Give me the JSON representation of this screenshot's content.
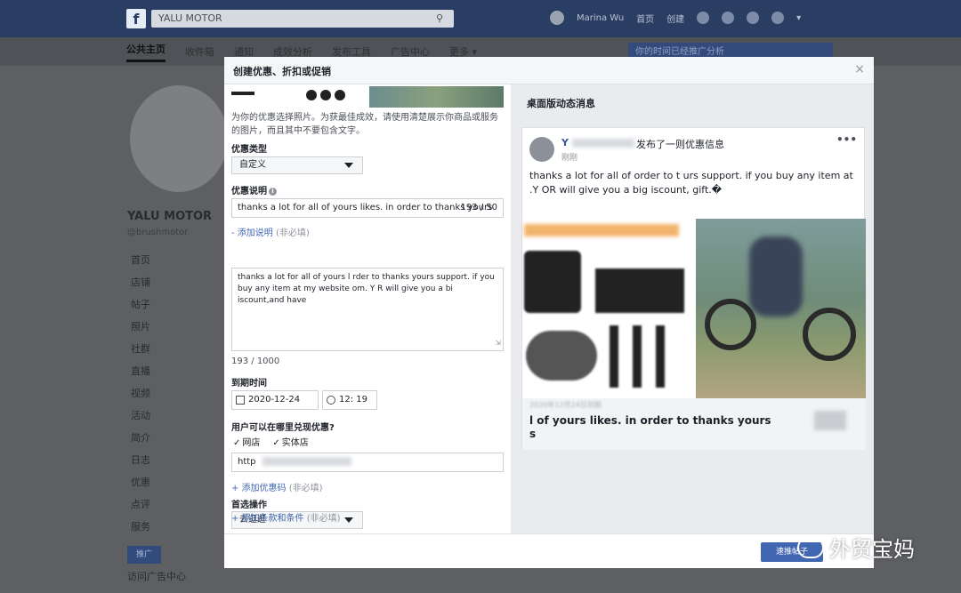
{
  "topbar": {
    "logo": "f",
    "search_value": "YALU MOTOR",
    "search_icon": "search-icon",
    "user_name": "Marina Wu",
    "home": "首页",
    "create": "创建"
  },
  "subnav": {
    "tabs": [
      "公共主页",
      "收件箱",
      "通知",
      "成效分析",
      "发布工具",
      "广告中心",
      "更多 ▾"
    ],
    "notice": "你的时间已经推广分析"
  },
  "left_page": {
    "page_name": "YALU MOTOR",
    "handle": "@brushmotor",
    "menu": [
      "首页",
      "店铺",
      "帖子",
      "照片",
      "社群",
      "直播",
      "视频",
      "活动",
      "简介",
      "日志",
      "优惠",
      "点评",
      "服务"
    ],
    "promote_button": "推广",
    "ad_center_link": "访问广告中心"
  },
  "modal": {
    "title": "创建优惠、折扣或促销",
    "close": "×",
    "photo_help": "为你的优惠选择照片。为获最佳成效，请使用清楚展示你商品或服务的图片，而且其中不要包含文字。",
    "offer_type_label": "优惠类型",
    "offer_type_value": "自定义",
    "offer_desc_label": "优惠说明",
    "offer_desc_value": "thanks a lot for all of yours likes. in order to thanks yours",
    "offer_desc_count": "193 / 50",
    "add_details_link": "- 添加说明",
    "optional": "(非必填)",
    "details_text": "thanks a lot for all of yours l      rder to thanks yours support. if you buy any item  at my website          om. Y          R will give you a bi      iscount,and have",
    "details_count": "193 / 1000",
    "expiry_label": "到期时间",
    "expiry_date": "2020-12-24",
    "expiry_time": "12: 19",
    "redeem_label": "用户可以在哪里兑现优惠?",
    "online": "网店",
    "in_store": "实体店",
    "url_value": "http",
    "add_code_link": "+ 添加优惠码",
    "cta_label": "首选操作",
    "cta_value": "去逛逛",
    "add_terms_link": "+ 添加条款和条件",
    "publish_button": "速推帖子"
  },
  "preview": {
    "title": "桌面版动态消息",
    "poster": "Y",
    "action": "发布了一则优惠信息",
    "sub": "刚刚",
    "body": "thanks a lot for all of            order to t          urs support. if you buy any item at            .Y        OR will give you a big     iscount,           gift.�",
    "footer_title": "       l of yours likes. in order to thanks yours s",
    "date_stamp": "2020年12月24日到期"
  },
  "watermark": "外贸宝妈"
}
